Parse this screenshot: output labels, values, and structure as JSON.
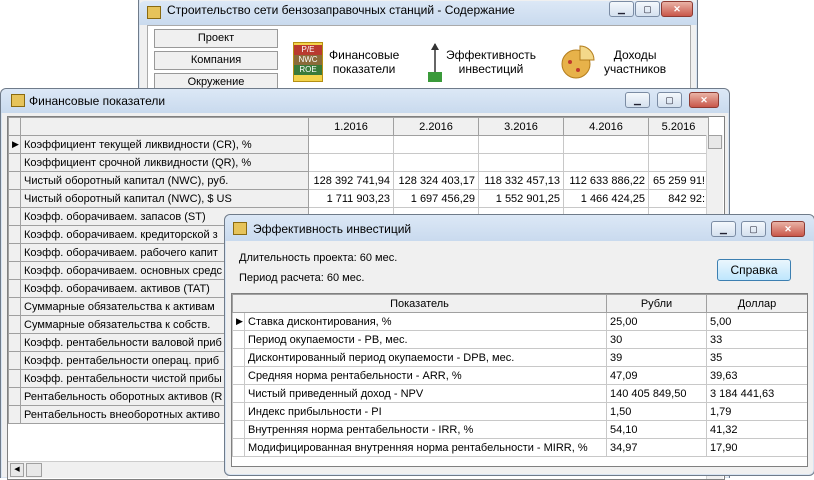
{
  "main_window": {
    "title": "Строительство сети бензозаправочных станций - Содержание",
    "nav_buttons": [
      "Проект",
      "Компания",
      "Окружение"
    ],
    "items": [
      {
        "label1": "Финансовые",
        "label2": "показатели",
        "icon_text": "P/E NWC ROE"
      },
      {
        "label1": "Эффективность",
        "label2": "инвестиций",
        "icon_text": "NPV"
      },
      {
        "label1": "Доходы",
        "label2": "участников",
        "icon_text": ""
      }
    ]
  },
  "fin_window": {
    "title": "Финансовые показатели",
    "columns": [
      "1.2016",
      "2.2016",
      "3.2016",
      "4.2016",
      "5.2016"
    ],
    "rows": [
      {
        "label": "Коэффициент текущей ликвидности (CR), %",
        "values": [
          "",
          "",
          "",
          "",
          ""
        ]
      },
      {
        "label": "Коэффициент срочной ликвидности (QR), %",
        "values": [
          "",
          "",
          "",
          "",
          ""
        ]
      },
      {
        "label": "Чистый оборотный капитал (NWC), руб.",
        "values": [
          "128 392 741,94",
          "128 324 403,17",
          "118 332 457,13",
          "112 633 886,22",
          "65 259 91!"
        ]
      },
      {
        "label": "Чистый оборотный капитал (NWC), $ US",
        "values": [
          "1 711 903,23",
          "1 697 456,29",
          "1 552 901,25",
          "1 466 424,25",
          "842 92:"
        ]
      },
      {
        "label": "Коэфф. оборачиваем. запасов (ST)",
        "values": [
          "",
          "",
          "",
          "",
          ""
        ]
      },
      {
        "label": "Коэфф. оборачиваем. кредиторской з",
        "values": [
          "",
          "",
          "",
          "",
          ""
        ]
      },
      {
        "label": "Коэфф. оборачиваем. рабочего капит",
        "values": [
          "",
          "",
          "",
          "",
          ""
        ]
      },
      {
        "label": "Коэфф. оборачиваем. основных средс",
        "values": [
          "",
          "",
          "",
          "",
          ""
        ]
      },
      {
        "label": "Коэфф. оборачиваем. активов (TAT)",
        "values": [
          "",
          "",
          "",
          "",
          ""
        ]
      },
      {
        "label": "Суммарные обязательства к активам",
        "values": [
          "",
          "",
          "",
          "",
          ""
        ]
      },
      {
        "label": "Суммарные обязательства к собств.",
        "values": [
          "",
          "",
          "",
          "",
          ""
        ]
      },
      {
        "label": "Коэфф. рентабельности валовой приб",
        "values": [
          "",
          "",
          "",
          "",
          ""
        ]
      },
      {
        "label": "Коэфф. рентабельности операц. приб",
        "values": [
          "",
          "",
          "",
          "",
          ""
        ]
      },
      {
        "label": "Коэфф. рентабельности чистой прибы",
        "values": [
          "",
          "",
          "",
          "",
          ""
        ]
      },
      {
        "label": "Рентабельность оборотных активов (R",
        "values": [
          "",
          "",
          "",
          "",
          ""
        ]
      },
      {
        "label": "Рентабельность внеоборотных активо",
        "values": [
          "",
          "",
          "",
          "",
          ""
        ]
      }
    ]
  },
  "eff_window": {
    "title": "Эффективность инвестиций",
    "duration": "Длительность проекта: 60 мес.",
    "period": "Период расчета: 60 мес.",
    "help_button": "Справка",
    "headers": [
      "Показатель",
      "Рубли",
      "Доллар"
    ],
    "rows": [
      {
        "label": "Ставка дисконтирования, %",
        "rub": "25,00",
        "usd": "5,00"
      },
      {
        "label": "Период окупаемости - PB, мес.",
        "rub": "30",
        "usd": "33"
      },
      {
        "label": "Дисконтированный период окупаемости - DPB, мес.",
        "rub": "39",
        "usd": "35"
      },
      {
        "label": "Средняя норма рентабельности - ARR, %",
        "rub": "47,09",
        "usd": "39,63"
      },
      {
        "label": "Чистый приведенный доход - NPV",
        "rub": "140 405 849,50",
        "usd": "3 184 441,63"
      },
      {
        "label": "Индекс прибыльности - PI",
        "rub": "1,50",
        "usd": "1,79"
      },
      {
        "label": "Внутренняя норма рентабельности - IRR, %",
        "rub": "54,10",
        "usd": "41,32"
      },
      {
        "label": "Модифицированная внутренняя норма рентабельности - MIRR, %",
        "rub": "34,97",
        "usd": "17,90"
      }
    ]
  },
  "colors": {
    "title_bg": "#c9daee",
    "close_btn": "#c9574a",
    "help_btn": "#bee6fd"
  }
}
